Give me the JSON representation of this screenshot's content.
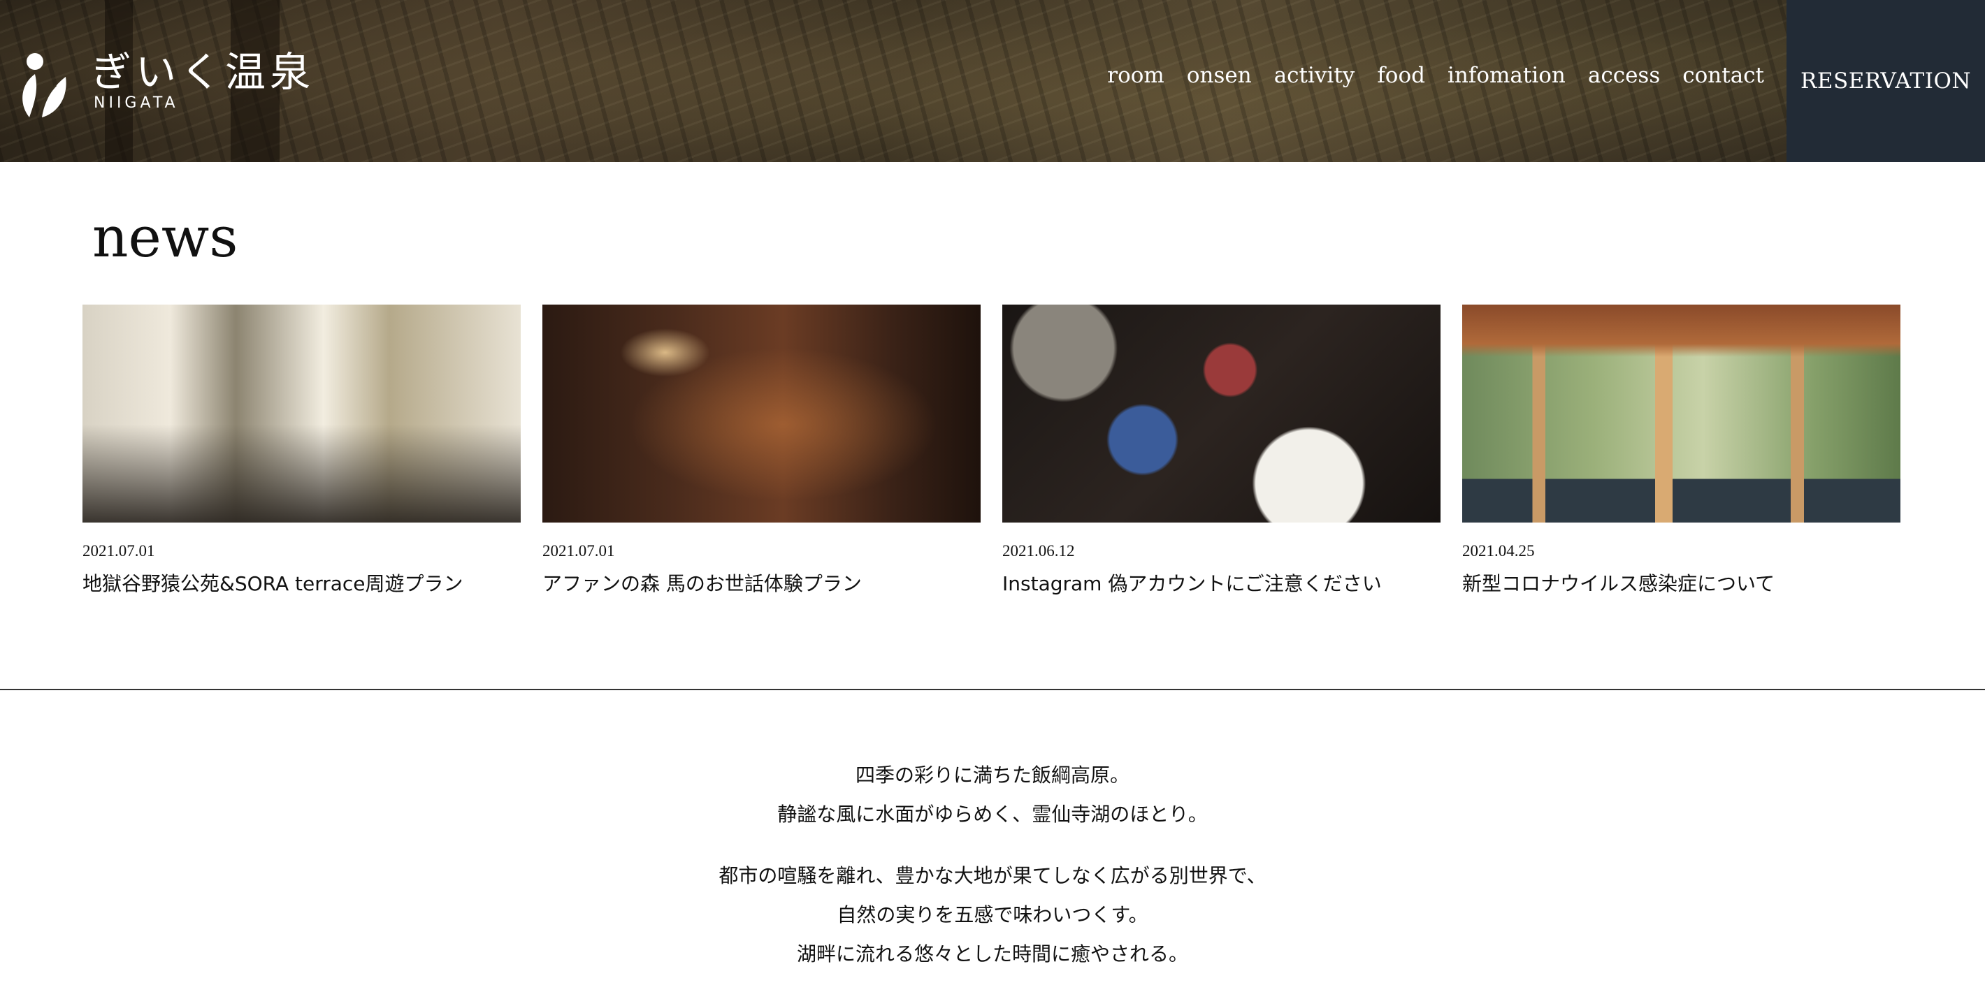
{
  "brand": {
    "title": "ぎいく温泉",
    "subtitle": "NIIGATA",
    "logo_icon": "leaf-drop-logo-icon"
  },
  "nav": {
    "items": [
      "room",
      "onsen",
      "activity",
      "food",
      "infomation",
      "access",
      "contact"
    ],
    "reservation": "RESERVATION"
  },
  "news": {
    "title": "news",
    "items": [
      {
        "date": "2021.07.01",
        "title": "地獄谷野猿公苑&SORA terrace周遊プラン",
        "image": "lounge-photo"
      },
      {
        "date": "2021.07.01",
        "title": "アファンの森 馬のお世話体験プラン",
        "image": "bar-photo"
      },
      {
        "date": "2021.06.12",
        "title": "Instagram 偽アカウントにご注意ください",
        "image": "kaiseki-food-photo"
      },
      {
        "date": "2021.04.25",
        "title": "新型コロナウイルス感染症について",
        "image": "gazebo-bath-photo"
      }
    ]
  },
  "intro": {
    "lines_a": [
      "四季の彩りに満ちた飯綱高原。",
      "静謐な風に水面がゆらめく、霊仙寺湖のほとり。"
    ],
    "lines_b": [
      "都市の喧騒を離れ、豊かな大地が果てしなく広がる別世界で、",
      "自然の実りを五感で味わいつくす。",
      "湖畔に流れる悠々とした時間に癒やされる。"
    ]
  },
  "colors": {
    "reservation_bg": "#222b36",
    "header_text": "#ffffff",
    "body_text": "#111111"
  }
}
